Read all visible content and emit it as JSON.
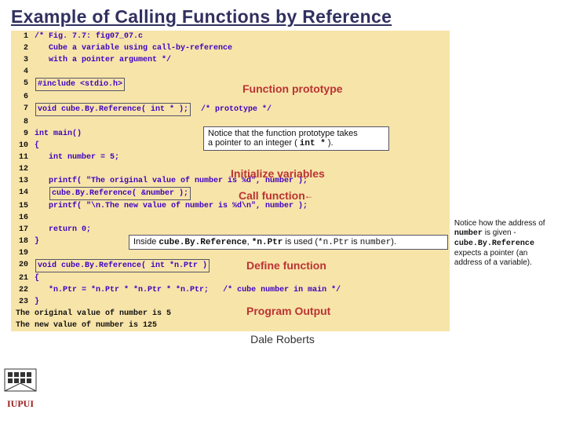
{
  "title": "Example of Calling Functions by Reference",
  "code": {
    "l1": "/* Fig. 7.7: fig07_07.c",
    "l2": "   Cube a variable using call-by-reference",
    "l3": "   with a pointer argument */",
    "l5": "#include <stdio.h>",
    "l7a": "void cube.By.Reference( int * );",
    "l7b": "/* prototype */",
    "l9": "int main()",
    "l10": "{",
    "l11": "   int number = 5;",
    "l13": "   printf( \"The original value of number is %d\", number );",
    "l14": "cube.By.Reference( &number );",
    "l15": "   printf( \"\\n.The new value of number is %d\\n\", number );",
    "l17": "   return 0;",
    "l18": "}",
    "l20a": "void cube.By.Reference( int *n.Ptr )",
    "l21": "{",
    "l22a": "   *n.Ptr = *n.Ptr * *n.Ptr * *n.Ptr;",
    "l22b": "/* cube number in main */",
    "l23": "}",
    "out1": "The original value of number is 5",
    "out2": "The new value of number is 125"
  },
  "lbl": {
    "proto": "Function prototype",
    "init": "Initialize variables",
    "call": "Call function",
    "define": "Define function",
    "output": "Program Output"
  },
  "notes": {
    "n1a": "Notice that the function prototype takes",
    "n1b": "a pointer to an integer ( ",
    "n1c": "int *",
    "n1d": " ).",
    "n2a": "Inside ",
    "n2b": "cube.By.Reference",
    "n2c": ", ",
    "n2d": "*n.Ptr",
    "n2e": " is used (",
    "n2f": "*n.Ptr",
    "n2g": " is ",
    "n2h": "number",
    "n2i": ").",
    "side1": "Notice how the address of ",
    "side2": "number",
    "side3": " is given -",
    "side4": "cube.By.Reference",
    "side5": " expects a pointer (an address of a variable)."
  },
  "footer": "Dale Roberts"
}
